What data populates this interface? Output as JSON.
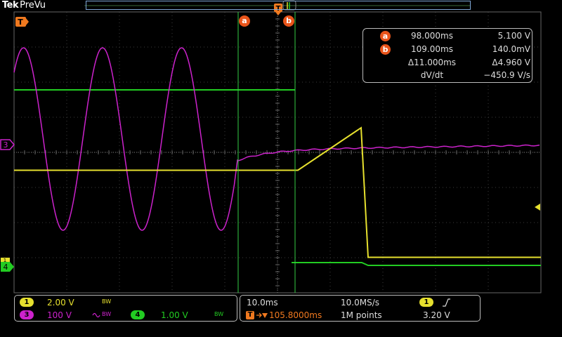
{
  "brand": {
    "name": "Tek",
    "mode": "PreVu"
  },
  "colors": {
    "ch1": "#e6e02e",
    "ch3": "#cc22cc",
    "ch4": "#22cc22",
    "cursor": "#e9541a",
    "trigger": "#f0791f",
    "cursor_line": "#33cc44"
  },
  "waveforms": {
    "timebase_s_per_div": 0.01,
    "ch1_high_volts": 5.1,
    "ch1_low_volts": 0.14,
    "ch3_sine_period_ms": 15,
    "ch4_high_volts": 1.0,
    "ch4_low_volts": 0.0
  },
  "cursors": {
    "a": {
      "label": "a",
      "time": "98.000ms",
      "value": "5.100 V"
    },
    "b": {
      "label": "b",
      "time": "109.00ms",
      "value": "140.0mV"
    },
    "delta": {
      "time": "Δ11.000ms",
      "value": "Δ4.960 V"
    },
    "slope": {
      "label": "dV/dt",
      "value": "−450.9 V/s"
    }
  },
  "markers": {
    "trigger": "T",
    "ch3": "3",
    "ch4": "4",
    "ch1": "1"
  },
  "channels": {
    "ch1": {
      "label": "1",
      "scale": "2.00 V",
      "bw": "BW"
    },
    "ch3": {
      "label": "3",
      "scale": "100 V",
      "bw": "BW"
    },
    "ch4": {
      "label": "4",
      "scale": "1.00 V",
      "bw": "BW"
    }
  },
  "horizontal": {
    "scale": "10.0ms",
    "sample_rate": "10.0MS/s",
    "trigger_position": "105.8000ms",
    "record_length": "1M points"
  },
  "trigger": {
    "source": "1",
    "slope": "rising-edge-icon",
    "level": "3.20 V"
  }
}
